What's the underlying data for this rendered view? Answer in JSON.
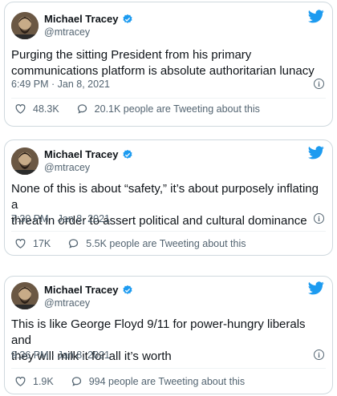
{
  "tweets": [
    {
      "name": "Michael Tracey",
      "handle": "@mtracey",
      "text": "Purging the sitting President from his primary\ncommunications platform is absolute authoritarian lunacy",
      "time": "6:49 PM · Jan 8, 2021",
      "likes": "48.3K",
      "replies": "20.1K people are Tweeting about this"
    },
    {
      "name": "Michael Tracey",
      "handle": "@mtracey",
      "text": "None of this is about “safety,” it’s about purposely inflating a\nthreat in order to assert political and cultural dominance",
      "time": "7:30 PM · Jan 8, 2021",
      "likes": "17K",
      "replies": "5.5K people are Tweeting about this"
    },
    {
      "name": "Michael Tracey",
      "handle": "@mtracey",
      "text": "This is like George Floyd 9/11 for power-hungry liberals and\nthey will milk it for all it’s worth",
      "time": "9:36 PM · Jan 8, 2021",
      "likes": "1.9K",
      "replies": "994 people are Tweeting about this"
    }
  ],
  "icons": {
    "verified": "verified-badge-icon",
    "bird": "twitter-bird-icon",
    "info": "info-icon",
    "heart": "heart-icon",
    "reply": "speech-bubble-icon"
  },
  "colors": {
    "brand": "#1d9bf0",
    "muted": "#536471",
    "border": "#cfd9de"
  }
}
